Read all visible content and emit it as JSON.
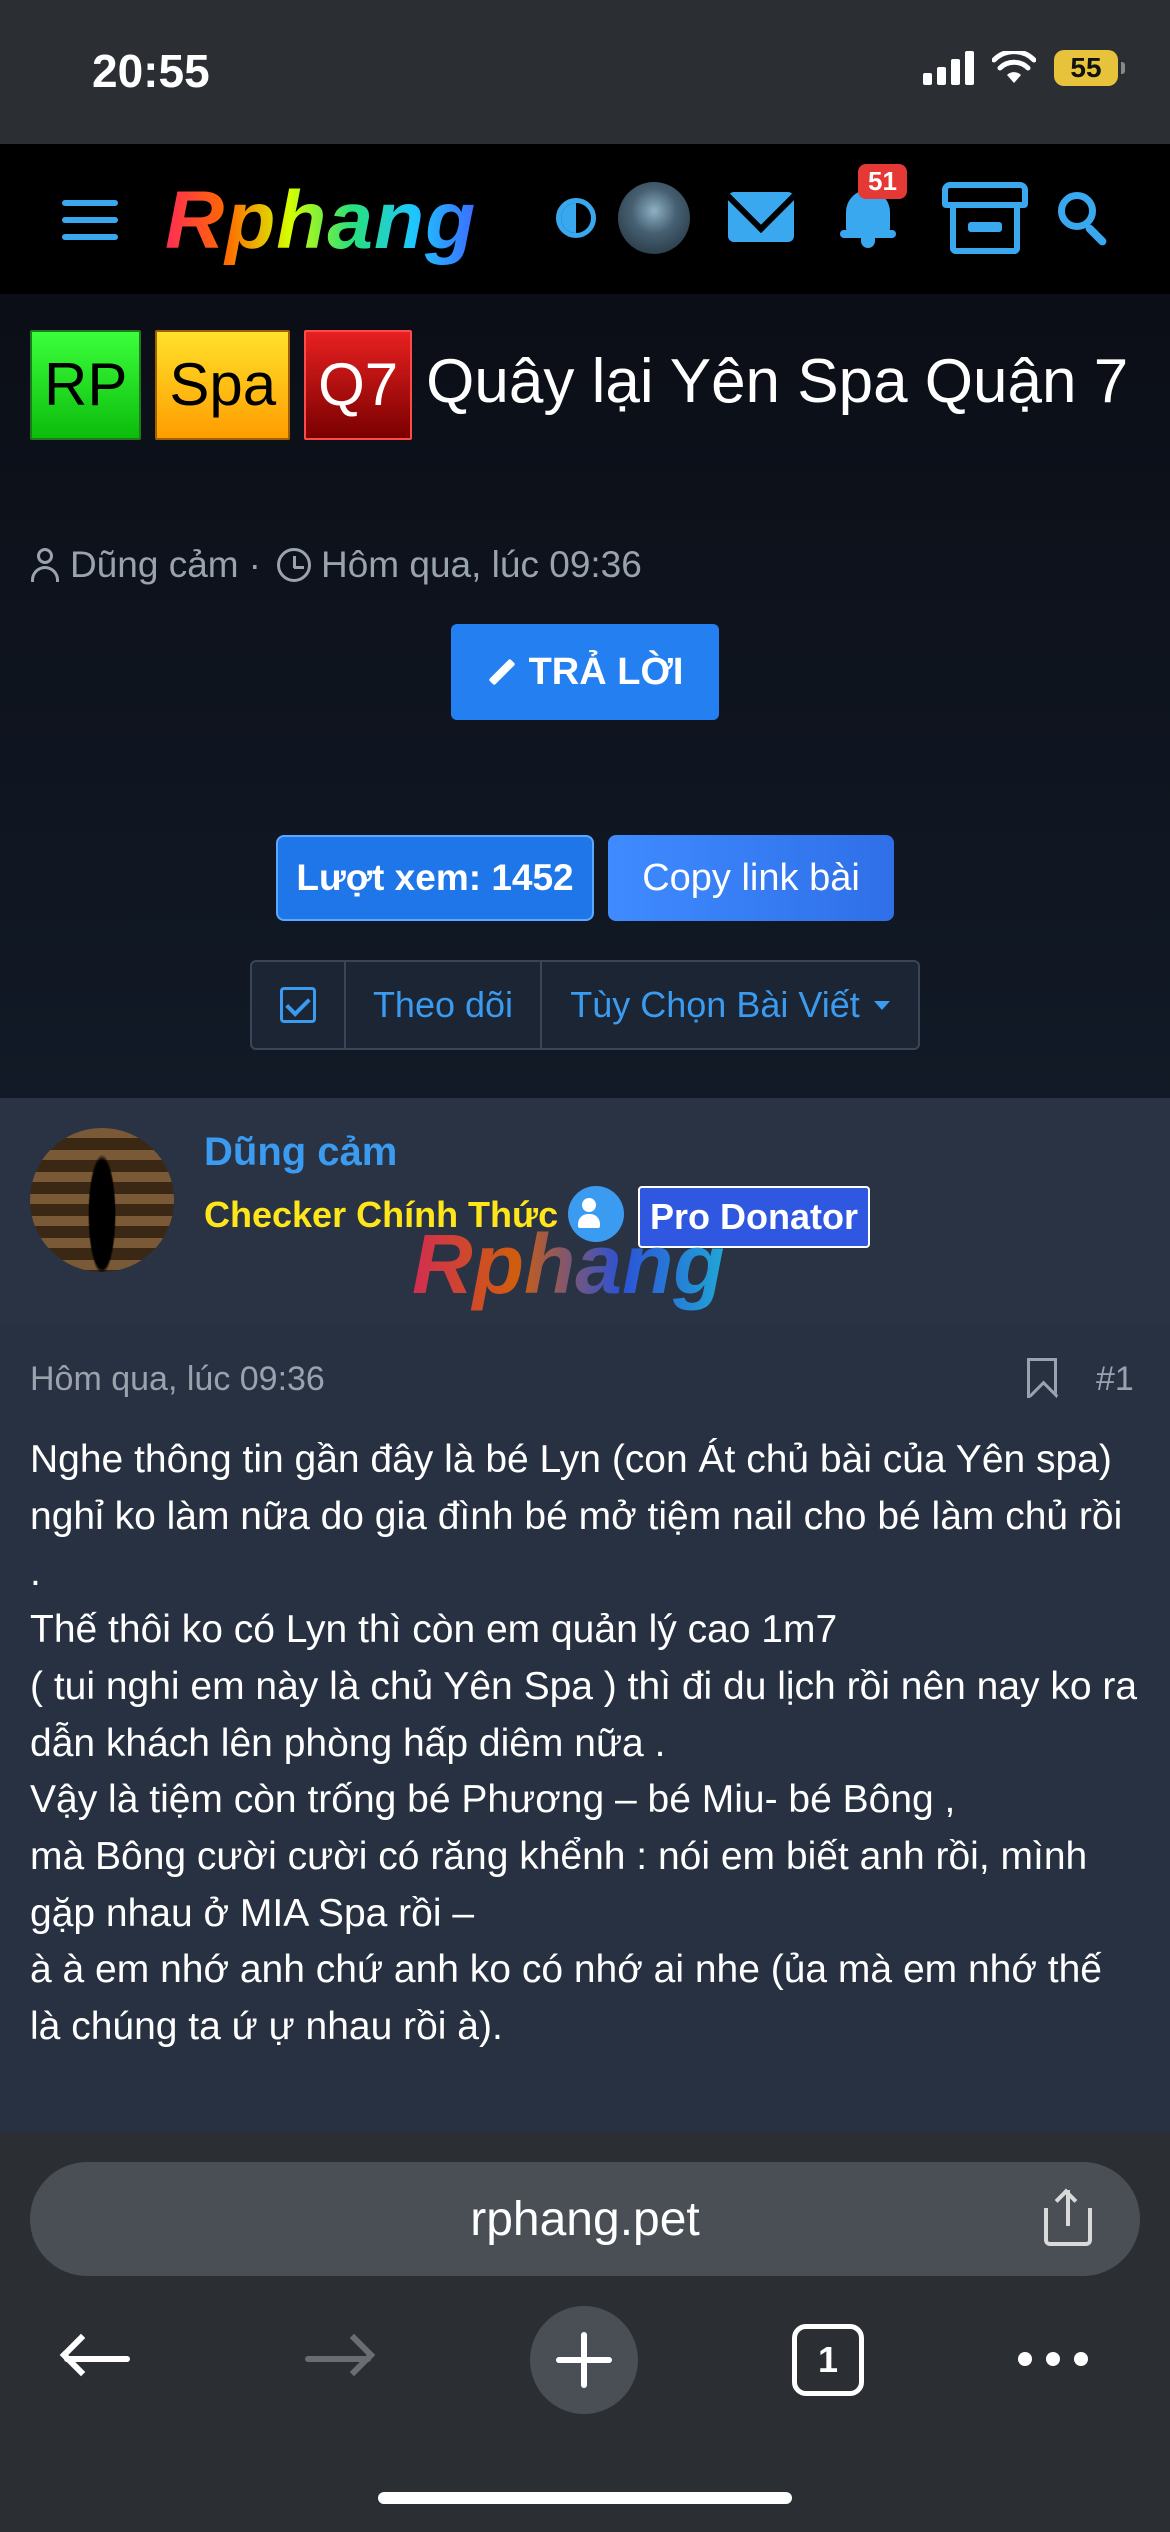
{
  "status_bar": {
    "time": "20:55",
    "battery": "55",
    "icons": [
      "signal-icon",
      "wifi-icon",
      "battery-icon"
    ]
  },
  "nav": {
    "logo": "Rphang",
    "notification_count": "51",
    "icons": [
      "menu-icon",
      "contrast-icon",
      "avatar",
      "mail-icon",
      "bell-icon",
      "store-icon",
      "search-icon"
    ],
    "accent_color": "#3aa8ef"
  },
  "thread": {
    "prefixes": [
      {
        "label": "RP",
        "color": "#1fd11f"
      },
      {
        "label": "Spa",
        "color": "#ffc21a"
      },
      {
        "label": "Q7",
        "color": "#c41a1a"
      }
    ],
    "title": "Quây lại Yên Spa Quận 7",
    "author": "Dũng cảm",
    "separator": "·",
    "date": "Hôm qua, lúc 09:36",
    "reply_label": "TRẢ LỜI",
    "views_label": "Lượt xem: 1452",
    "copy_label": "Copy link bài",
    "follow_label": "Theo dõi",
    "post_options_label": "Tùy Chọn Bài Viết"
  },
  "post": {
    "author_name": "Dũng cảm",
    "author_title": "Checker Chính Thức",
    "badge": "Pro Donator",
    "watermark": "Rphang",
    "date": "Hôm qua, lúc 09:36",
    "number": "#1",
    "lines": [
      "Nghe thông tin gần đây là bé Lyn (con Át chủ bài của Yên spa)",
      "nghỉ ko làm nữa do gia đình bé mở tiệm nail cho bé làm chủ rồi .",
      "Thế thôi ko có Lyn thì còn em quản lý cao 1m7",
      "( tui nghi em này là chủ Yên Spa ) thì đi du lịch rồi nên nay ko ra dẫn khách lên phòng hấp diêm nữa .",
      "Vậy là tiệm còn trống bé Phương – bé Miu- bé Bông ,",
      "mà Bông cười cười có răng khểnh : nói em biết anh rồi, mình gặp nhau ở MIA Spa rồi –",
      "à à em nhớ anh chứ anh ko có nhớ ai nhe (ủa mà em nhớ thế là chúng ta ứ ự nhau rồi à)."
    ]
  },
  "browser": {
    "url": "rphang.pet",
    "tab_count": "1"
  }
}
